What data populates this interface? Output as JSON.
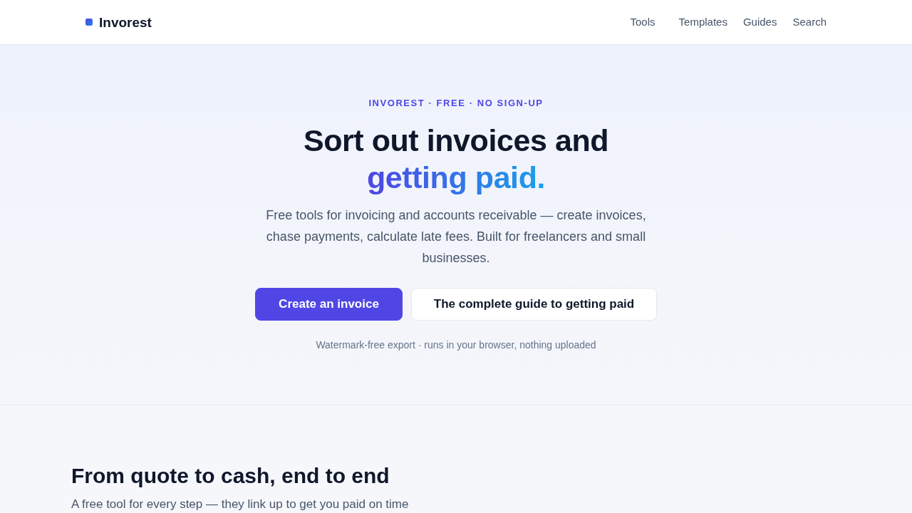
{
  "header": {
    "logo": "Invorest",
    "nav": [
      {
        "label": "Tools"
      },
      {
        "label": "Templates"
      },
      {
        "label": "Guides"
      },
      {
        "label": "Search"
      }
    ]
  },
  "hero": {
    "eyebrow": "INVOREST · FREE · NO SIGN-UP",
    "title": "Sort out invoices and",
    "title_highlight": "getting paid.",
    "description": "Free tools for invoicing and accounts receivable — create invoices, chase payments, calculate late fees. Built for freelancers and small businesses.",
    "buttons": [
      {
        "label": "Create an invoice",
        "kind": "primary"
      },
      {
        "label": "The complete guide to getting paid",
        "kind": "secondary"
      }
    ],
    "note": "Watermark-free export · runs in your browser, nothing uploaded"
  },
  "section": {
    "title": "From quote to cash, end to end",
    "subtitle": "A free tool for every step — they link up to get you paid on time"
  }
}
